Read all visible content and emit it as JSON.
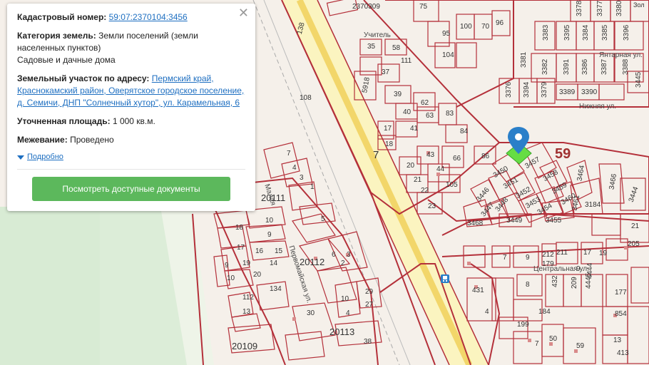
{
  "popup": {
    "cadastral_label": "Кадастровый номер:",
    "cadastral_value": "59:07:2370104:3456",
    "category_label": "Категория земель:",
    "category_value_1": "Земли поселений (земли",
    "category_value_2": "населенных пунктов)",
    "category_value_3": "Садовые и дачные дома",
    "address_label": "Земельный участок по адресу:",
    "address_1": "Пермский край,",
    "address_2": "Краснокамский район, Оверятское городское поселение,",
    "address_3": "д. Семичи, ДНП \"Солнечный хутор\", ул. Карамельная, 6",
    "area_label": "Уточненная площадь:",
    "area_value": "1 000 кв.м.",
    "survey_label": "Межевание:",
    "survey_value": "Проведено",
    "more_label": "Подробно",
    "button_label": "Посмотреть доступные документы",
    "close_glyph": "✕"
  },
  "map": {
    "region_label": "59",
    "quarter_labels": [
      "2370309",
      "20111",
      "20112",
      "20113",
      "20109"
    ],
    "streets": [
      "Учитель",
      "Янтарная ул.",
      "Нижняя ул.",
      "Центральная ул.",
      "Первомайская ул.",
      "Малая"
    ],
    "road_number": "138",
    "plots_right": [
      "3378",
      "3377",
      "3380",
      "3383",
      "3395",
      "3384",
      "3385",
      "3381",
      "3382",
      "3391",
      "3386",
      "3387",
      "3376",
      "3394",
      "3379",
      "3389",
      "3390",
      "3388",
      "3445",
      "3450",
      "3457",
      "3458",
      "3459",
      "3460",
      "3461",
      "3446",
      "3451",
      "3452",
      "3453",
      "3454",
      "3455",
      "3447",
      "3448",
      "3449",
      "3468",
      "3464",
      "3466",
      "3184",
      "3444"
    ],
    "plots_mid": [
      "75",
      "95",
      "100",
      "70",
      "96",
      "104",
      "35",
      "58",
      "37",
      "111",
      "5918",
      "39",
      "62",
      "40",
      "63",
      "41",
      "17",
      "18",
      "83",
      "84",
      "86",
      "43",
      "20",
      "21",
      "44",
      "66",
      "22",
      "105",
      "23",
      "108",
      "7"
    ],
    "plots_left": [
      "7",
      "4",
      "3",
      "1",
      "5",
      "18",
      "10",
      "9",
      "17",
      "16",
      "15",
      "14",
      "19",
      "20",
      "9",
      "10",
      "13",
      "112",
      "134",
      "6",
      "2",
      "3",
      "10",
      "29",
      "38",
      "27",
      "30",
      "4",
      "20"
    ],
    "plots_bottom_right": [
      "7",
      "9",
      "212",
      "211",
      "17",
      "179",
      "4444",
      "431",
      "432",
      "209",
      "4445",
      "8",
      "4",
      "184",
      "199",
      "7",
      "50",
      "59",
      "413",
      "854",
      "177",
      "205",
      "21"
    ],
    "bus_stop_icon": "bus-stop-icon"
  },
  "colors": {
    "plot_border": "#b4303a",
    "button": "#5cb85c",
    "link": "#1e6fc1",
    "selected_plot": "#66dd44",
    "marker": "#2a7fc9",
    "road": "#fff6b0"
  }
}
